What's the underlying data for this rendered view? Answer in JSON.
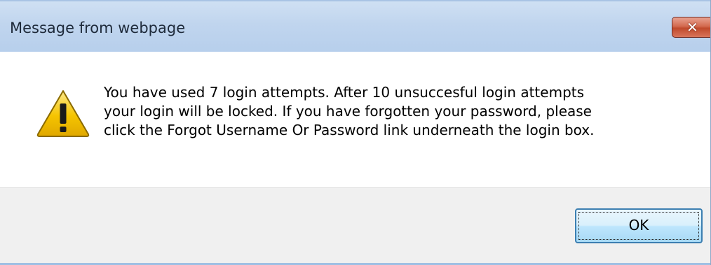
{
  "window": {
    "title": "Message from webpage",
    "close_icon": "close-icon",
    "close_glyph": "✕"
  },
  "message": {
    "icon": "warning-icon",
    "lines": [
      "You have used 7 login attempts. After 10 unsuccesful login attempts",
      "your login will be locked. If you have forgotten your password, please",
      "click the Forgot Username Or Password link underneath the login box."
    ]
  },
  "buttons": {
    "ok_label": "OK"
  },
  "colors": {
    "titlebar": "#c0d5ee",
    "close_button": "#c04a2c",
    "warning_fill": "#f2c200",
    "footer": "#f0f0f0",
    "ok_border": "#3c7fb1"
  }
}
